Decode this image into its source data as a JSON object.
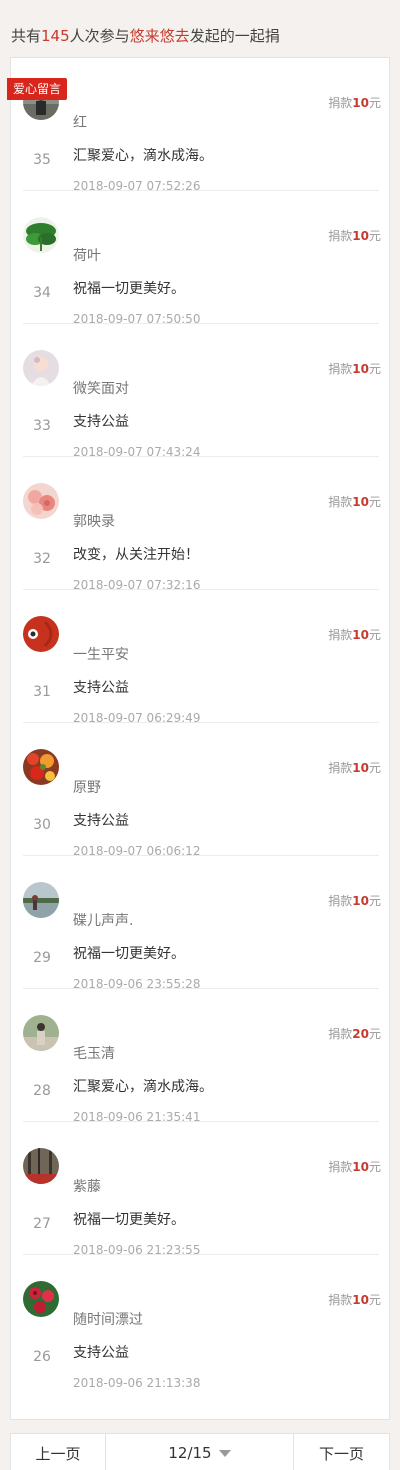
{
  "header": {
    "prefix": "共有",
    "count": "145",
    "middle": "人次参与",
    "organizer": "悠来悠去",
    "suffix": "发起的一起捐"
  },
  "panel": {
    "tag": "爱心留言"
  },
  "amount_prefix": "捐款",
  "amount_suffix": "元",
  "entries": [
    {
      "rank": "35",
      "name": "红",
      "message": "汇聚爱心，滴水成海。",
      "time": "2018-09-07 07:52:26",
      "amount": "10",
      "avatar_icon": "avatar-person-icon"
    },
    {
      "rank": "34",
      "name": "荷叶",
      "message": "祝福一切更美好。",
      "time": "2018-09-07 07:50:50",
      "amount": "10",
      "avatar_icon": "avatar-leaf-icon"
    },
    {
      "rank": "33",
      "name": "微笑面对",
      "message": "支持公益",
      "time": "2018-09-07 07:43:24",
      "amount": "10",
      "avatar_icon": "avatar-child-icon"
    },
    {
      "rank": "32",
      "name": "郭映录",
      "message": "改变，从关注开始！",
      "time": "2018-09-07 07:32:16",
      "amount": "10",
      "avatar_icon": "avatar-flower-icon"
    },
    {
      "rank": "31",
      "name": "一生平安",
      "message": "支持公益",
      "time": "2018-09-07 06:29:49",
      "amount": "10",
      "avatar_icon": "avatar-red-icon"
    },
    {
      "rank": "30",
      "name": "原野",
      "message": "支持公益",
      "time": "2018-09-07 06:06:12",
      "amount": "10",
      "avatar_icon": "avatar-bouquet-icon"
    },
    {
      "rank": "29",
      "name": "碟儿声声.",
      "message": "祝福一切更美好。",
      "time": "2018-09-06 23:55:28",
      "amount": "10",
      "avatar_icon": "avatar-lake-icon"
    },
    {
      "rank": "28",
      "name": "毛玉清",
      "message": "汇聚爱心，滴水成海。",
      "time": "2018-09-06 21:35:41",
      "amount": "20",
      "avatar_icon": "avatar-outdoor-icon"
    },
    {
      "rank": "27",
      "name": "紫藤",
      "message": "祝福一切更美好。",
      "time": "2018-09-06 21:23:55",
      "amount": "10",
      "avatar_icon": "avatar-forest-icon"
    },
    {
      "rank": "26",
      "name": "随时间漂过",
      "message": "支持公益",
      "time": "2018-09-06 21:13:38",
      "amount": "10",
      "avatar_icon": "avatar-rose-icon"
    }
  ],
  "pager": {
    "prev": "上一页",
    "page": "12/15",
    "next": "下一页"
  },
  "colors": {
    "accent": "#c83a2e",
    "tag_bg": "#d9261c"
  }
}
